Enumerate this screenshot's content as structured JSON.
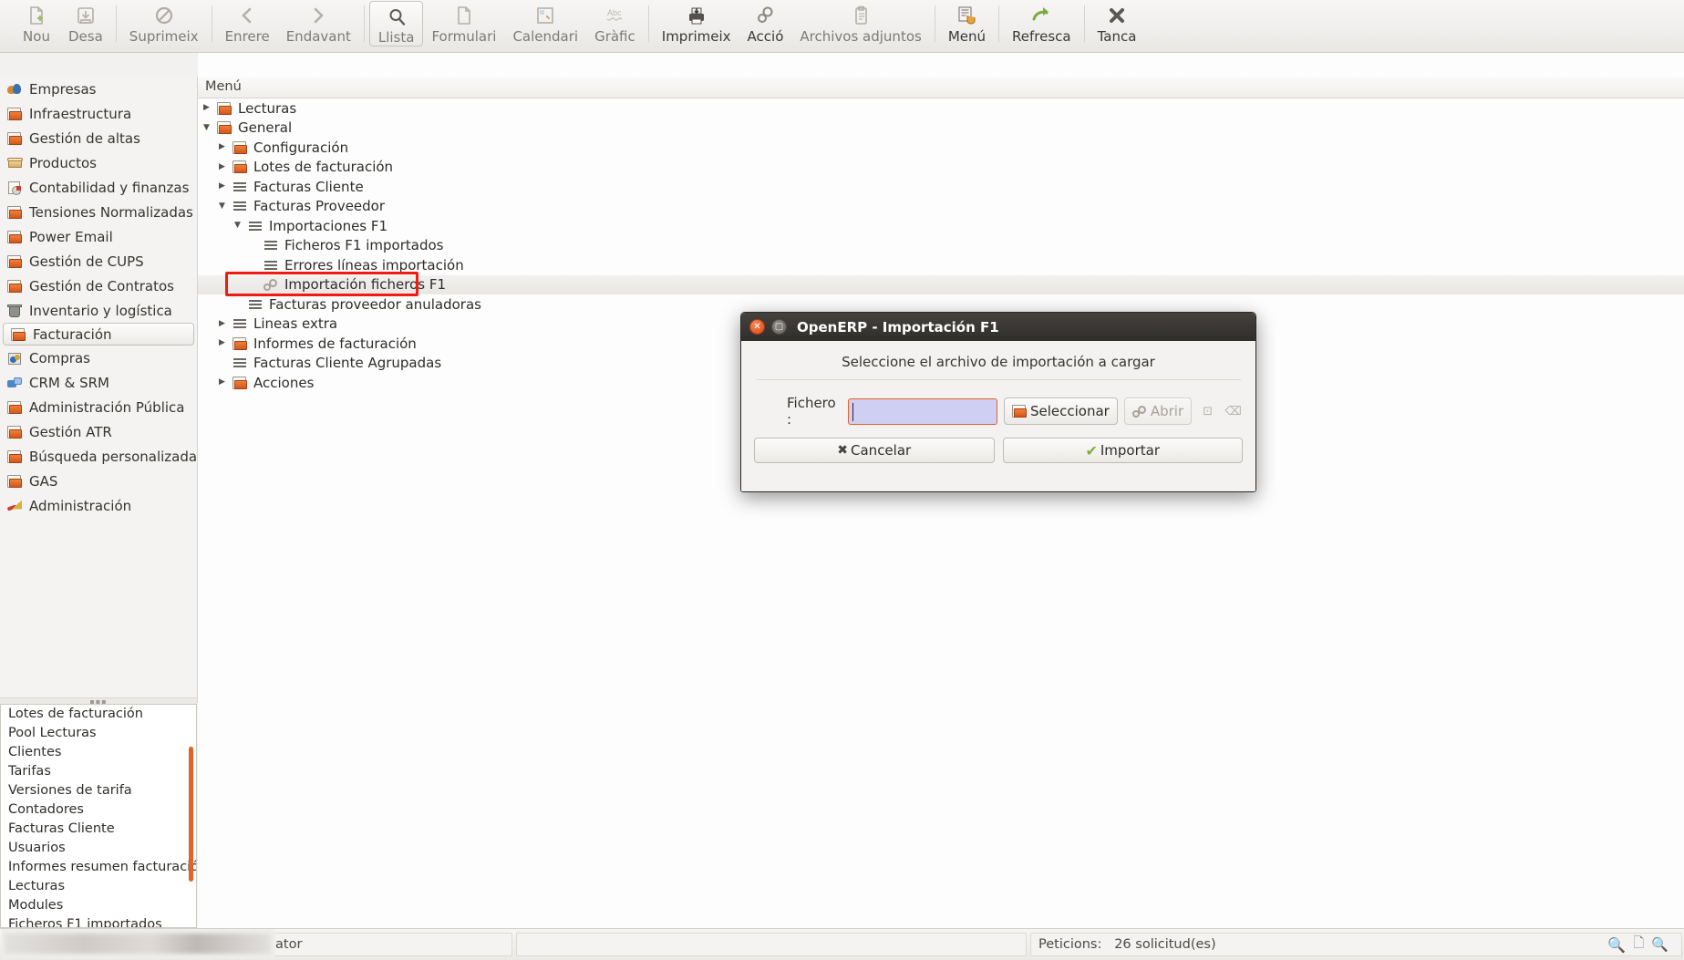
{
  "toolbar": {
    "items": [
      {
        "label": "Nou",
        "icon": "new-document-icon",
        "state": "disabled"
      },
      {
        "label": "Desa",
        "icon": "save-icon",
        "state": "disabled"
      },
      {
        "label": "Suprimeix",
        "icon": "delete-icon",
        "state": "disabled"
      },
      {
        "label": "Enrere",
        "icon": "back-arrow-icon",
        "state": "disabled"
      },
      {
        "label": "Endavant",
        "icon": "forward-arrow-icon",
        "state": "disabled"
      },
      {
        "label": "Llista",
        "icon": "list-search-icon",
        "state": "pressed"
      },
      {
        "label": "Formulari",
        "icon": "form-icon",
        "state": "disabled"
      },
      {
        "label": "Calendari",
        "icon": "calendar-icon",
        "state": "disabled"
      },
      {
        "label": "Gràfic",
        "icon": "graph-icon",
        "state": "disabled"
      },
      {
        "label": "Imprimeix",
        "icon": "printer-icon",
        "state": "enabled"
      },
      {
        "label": "Acció",
        "icon": "gears-icon",
        "state": "enabled"
      },
      {
        "label": "Archivos adjuntos",
        "icon": "attachment-icon",
        "state": "disabled"
      },
      {
        "label": "Menú",
        "icon": "menu-hand-icon",
        "state": "enabled"
      },
      {
        "label": "Refresca",
        "icon": "refresh-arrow-icon",
        "state": "enabled"
      },
      {
        "label": "Tanca",
        "icon": "close-x-icon",
        "state": "enabled"
      }
    ]
  },
  "tab": {
    "label": "Menú",
    "close_icon": "close-icon"
  },
  "sidebar": {
    "items": [
      {
        "label": "Empresas",
        "icon": "people-icon",
        "selected": false
      },
      {
        "label": "Infraestructura",
        "icon": "folder-icon",
        "selected": false
      },
      {
        "label": "Gestión de altas",
        "icon": "folder-icon",
        "selected": false
      },
      {
        "label": "Productos",
        "icon": "box-icon",
        "selected": false
      },
      {
        "label": "Contabilidad y finanzas",
        "icon": "chart-page-icon",
        "selected": false
      },
      {
        "label": "Tensiones Normalizadas",
        "icon": "folder-icon",
        "selected": false
      },
      {
        "label": "Power Email",
        "icon": "folder-icon",
        "selected": false
      },
      {
        "label": "Gestión de CUPS",
        "icon": "folder-icon",
        "selected": false
      },
      {
        "label": "Gestión de Contratos",
        "icon": "folder-icon",
        "selected": false
      },
      {
        "label": "Inventario y logística",
        "icon": "trash-icon",
        "selected": false
      },
      {
        "label": "Facturación",
        "icon": "folder-icon",
        "selected": true
      },
      {
        "label": "Compras",
        "icon": "cart-icon",
        "selected": false
      },
      {
        "label": "CRM & SRM",
        "icon": "crm-icon",
        "selected": false
      },
      {
        "label": "Administración Pública",
        "icon": "folder-icon",
        "selected": false
      },
      {
        "label": "Gestión ATR",
        "icon": "folder-icon",
        "selected": false
      },
      {
        "label": "Búsqueda personalizada",
        "icon": "folder-icon",
        "selected": false
      },
      {
        "label": "GAS",
        "icon": "folder-icon",
        "selected": false
      },
      {
        "label": "Administración",
        "icon": "admin-tools-icon",
        "selected": false
      }
    ]
  },
  "shortcuts": {
    "items": [
      {
        "label": "Lotes de facturación"
      },
      {
        "label": "Pool Lecturas"
      },
      {
        "label": "Clientes"
      },
      {
        "label": "Tarifas"
      },
      {
        "label": "Versiones de tarifa"
      },
      {
        "label": "Contadores"
      },
      {
        "label": "Facturas Cliente"
      },
      {
        "label": "Usuarios"
      },
      {
        "label": "Informes resumen facturación"
      },
      {
        "label": "Lecturas"
      },
      {
        "label": "Modules"
      },
      {
        "label": "Ficheros F1 importados"
      }
    ]
  },
  "main": {
    "header": "Menú",
    "tree": [
      {
        "label": "Lecturas",
        "depth": 0,
        "arrow": "collapsed",
        "icon": "folder-icon",
        "highlighted": false
      },
      {
        "label": "General",
        "depth": 0,
        "arrow": "expanded",
        "icon": "folder-icon",
        "highlighted": false
      },
      {
        "label": "Configuración",
        "depth": 1,
        "arrow": "collapsed",
        "icon": "folder-icon",
        "highlighted": false
      },
      {
        "label": "Lotes de facturación",
        "depth": 1,
        "arrow": "collapsed",
        "icon": "folder-icon",
        "highlighted": false
      },
      {
        "label": "Facturas Cliente",
        "depth": 1,
        "arrow": "collapsed",
        "icon": "lines-icon",
        "highlighted": false
      },
      {
        "label": "Facturas Proveedor",
        "depth": 1,
        "arrow": "expanded",
        "icon": "lines-icon",
        "highlighted": false
      },
      {
        "label": "Importaciones F1",
        "depth": 2,
        "arrow": "expanded",
        "icon": "lines-icon",
        "highlighted": false
      },
      {
        "label": "Ficheros F1 importados",
        "depth": 3,
        "arrow": "none",
        "icon": "lines-icon",
        "highlighted": false
      },
      {
        "label": "Errores líneas importación",
        "depth": 3,
        "arrow": "none",
        "icon": "lines-icon",
        "highlighted": false
      },
      {
        "label": "Importación ficheros F1",
        "depth": 3,
        "arrow": "none",
        "icon": "gears-icon",
        "highlighted": true
      },
      {
        "label": "Facturas proveedor anuladoras",
        "depth": 2,
        "arrow": "none",
        "icon": "lines-icon",
        "highlighted": false
      },
      {
        "label": "Lineas extra",
        "depth": 1,
        "arrow": "collapsed",
        "icon": "lines-icon",
        "highlighted": false
      },
      {
        "label": "Informes de facturación",
        "depth": 1,
        "arrow": "collapsed",
        "icon": "folder-icon",
        "highlighted": false
      },
      {
        "label": "Facturas Cliente Agrupadas",
        "depth": 1,
        "arrow": "none",
        "icon": "lines-icon",
        "highlighted": false
      },
      {
        "label": "Acciones",
        "depth": 1,
        "arrow": "collapsed",
        "icon": "folder-icon",
        "highlighted": false
      }
    ]
  },
  "dialog": {
    "title": "OpenERP - Importación F1",
    "close_icon": "window-close-icon",
    "maximize_icon": "window-maximize-icon",
    "message": "Seleccione el archivo de importación a cargar",
    "file_label": "Fichero :",
    "file_value": "",
    "file_placeholder": "",
    "select_button": "Seleccionar",
    "open_button": "Abrir",
    "cancel_button": "Cancelar",
    "import_button": "Importar",
    "accent_color": "#e2622a",
    "field_bg": "#cfcff4"
  },
  "statusbar": {
    "user": "Administrator",
    "requests_label": "Peticions:",
    "requests_value": "26 solicitud(es)",
    "icons": [
      "search-icon",
      "new-request-icon",
      "zoom-icon"
    ]
  }
}
